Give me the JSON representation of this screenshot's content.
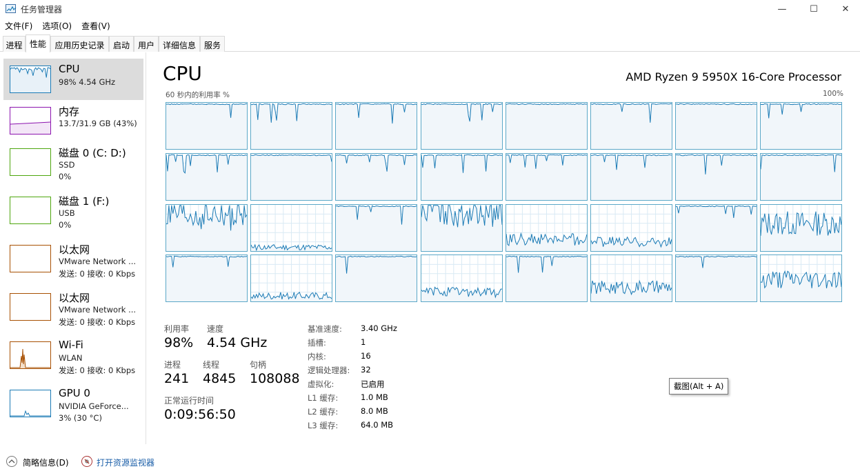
{
  "window": {
    "title": "任务管理器",
    "minimize_glyph": "—",
    "maximize_glyph": "☐",
    "close_glyph": "✕"
  },
  "menu": [
    "文件(F)",
    "选项(O)",
    "查看(V)"
  ],
  "tabs": [
    "进程",
    "性能",
    "应用历史记录",
    "启动",
    "用户",
    "详细信息",
    "服务"
  ],
  "active_tab": "性能",
  "sidebar": [
    {
      "title": "CPU",
      "sub": "98% 4.54 GHz",
      "sub2": "",
      "color": "#1a7ab5",
      "active": true
    },
    {
      "title": "内存",
      "sub": "13.7/31.9 GB (43%)",
      "sub2": "",
      "color": "#8b12ae",
      "active": false
    },
    {
      "title": "磁盘 0 (C: D:)",
      "sub": "SSD",
      "sub2": "0%",
      "color": "#4da60c",
      "active": false
    },
    {
      "title": "磁盘 1 (F:)",
      "sub": "USB",
      "sub2": "0%",
      "color": "#4da60c",
      "active": false
    },
    {
      "title": "以太网",
      "sub": "VMware Network ...",
      "sub2": "发送: 0 接收: 0 Kbps",
      "color": "#a74f01",
      "active": false
    },
    {
      "title": "以太网",
      "sub": "VMware Network ...",
      "sub2": "发送: 0 接收: 0 Kbps",
      "color": "#a74f01",
      "active": false
    },
    {
      "title": "Wi-Fi",
      "sub": "WLAN",
      "sub2": "发送: 0 接收: 0 Kbps",
      "color": "#a74f01",
      "active": false
    },
    {
      "title": "GPU 0",
      "sub": "NVIDIA GeForce...",
      "sub2": "3% (30 °C)",
      "color": "#1a7ab5",
      "active": false
    }
  ],
  "main": {
    "title": "CPU",
    "processor": "AMD Ryzen 9 5950X 16-Core Processor",
    "util_caption": "60 秒内的利用率 %",
    "max_caption": "100%",
    "core_levels": [
      0.97,
      0.97,
      0.97,
      0.97,
      0.97,
      0.97,
      0.97,
      0.97,
      0.97,
      0.97,
      0.97,
      0.97,
      0.97,
      0.97,
      0.97,
      0.97,
      0.75,
      0.08,
      0.97,
      0.9,
      0.25,
      0.2,
      0.97,
      0.6,
      0.95,
      0.12,
      0.97,
      0.2,
      0.97,
      0.3,
      0.97,
      0.45
    ],
    "stats": {
      "util_label": "利用率",
      "util_value": "98%",
      "speed_label": "速度",
      "speed_value": "4.54 GHz",
      "proc_label": "进程",
      "proc_value": "241",
      "thread_label": "线程",
      "thread_value": "4845",
      "handle_label": "句柄",
      "handle_value": "108088",
      "uptime_label": "正常运行时间",
      "uptime_value": "0:09:56:50"
    },
    "info": [
      {
        "label": "基准速度:",
        "value": "3.40 GHz"
      },
      {
        "label": "插槽:",
        "value": "1"
      },
      {
        "label": "内核:",
        "value": "16"
      },
      {
        "label": "逻辑处理器:",
        "value": "32"
      },
      {
        "label": "虚拟化:",
        "value": "已启用"
      },
      {
        "label": "L1 缓存:",
        "value": "1.0 MB"
      },
      {
        "label": "L2 缓存:",
        "value": "8.0 MB"
      },
      {
        "label": "L3 缓存:",
        "value": "64.0 MB"
      }
    ],
    "tooltip": "截图(Alt + A)"
  },
  "footer": {
    "summary": "简略信息(D)",
    "monitor": "打开资源监视器"
  },
  "colors": {
    "cpu_line": "#1a7ab5",
    "cpu_fill": "#f1f6fa",
    "core_border": "#5aa7c7",
    "grid": "#d9eaf4"
  }
}
